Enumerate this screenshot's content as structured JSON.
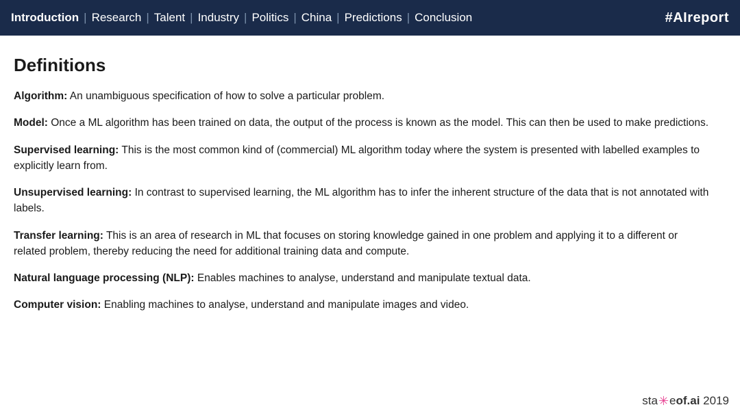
{
  "header": {
    "nav_items": [
      {
        "label": "Introduction",
        "active": true
      },
      {
        "label": "Research",
        "active": false
      },
      {
        "label": "Talent",
        "active": false
      },
      {
        "label": "Industry",
        "active": false
      },
      {
        "label": "Politics",
        "active": false
      },
      {
        "label": "China",
        "active": false
      },
      {
        "label": "Predictions",
        "active": false
      },
      {
        "label": "Conclusion",
        "active": false
      }
    ],
    "hashtag": "#AIreport"
  },
  "main": {
    "title": "Definitions",
    "definitions": [
      {
        "term": "Algorithm:",
        "text": " An unambiguous specification of how to solve a particular problem."
      },
      {
        "term": "Model:",
        "text": " Once a ML algorithm has been trained on data, the output of the process is known as the model. This can then be used to make predictions."
      },
      {
        "term": "Supervised learning:",
        "text": " This is the most common kind of (commercial) ML algorithm today where the system is presented with labelled examples to explicitly learn from."
      },
      {
        "term": "Unsupervised learning:",
        "text": " In contrast to supervised learning, the ML algorithm has to infer the inherent structure of the data that is not annotated with labels."
      },
      {
        "term": "Transfer learning:",
        "text": " This is an area of research in ML that focuses on storing knowledge gained in one problem and applying it to a different or related problem, thereby reducing the need for additional training data and compute."
      },
      {
        "term": "Natural language processing (NLP):",
        "text": " Enables machines to analyse, understand and manipulate textual data."
      },
      {
        "term": "Computer vision:",
        "text": " Enabling machines to analyse, understand and manipulate images and video."
      }
    ]
  },
  "footer": {
    "logo_prefix": "sta",
    "logo_suffix": ".ai",
    "logo_middle": "te",
    "year": "2019",
    "full_text": "state.ai 2019"
  }
}
